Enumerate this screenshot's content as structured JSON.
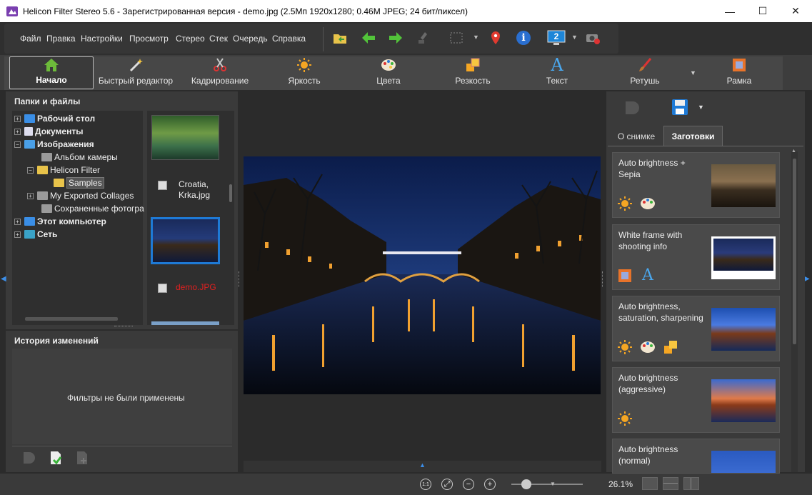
{
  "window": {
    "title": "Helicon Filter Stereo 5.6 - Зарегистрированная версия - demo.jpg (2.5Мп 1920x1280; 0.46М JPEG; 24 бит/пиксел)",
    "minimize_glyph": "—",
    "maximize_glyph": "☐",
    "close_glyph": "✕"
  },
  "menu": {
    "items": [
      "Файл",
      "Правка",
      "Настройки",
      "Просмотр",
      "Стерео",
      "Стек",
      "Очередь",
      "Справка"
    ]
  },
  "toolbar": {
    "icons": [
      "open-folder-icon",
      "back-arrow-icon",
      "forward-arrow-icon",
      "brush-icon",
      "selection-icon",
      "location-pin-icon",
      "info-icon",
      "monitor-icon",
      "camera-settings-icon"
    ],
    "monitor_number": "2",
    "info_glyph": "i"
  },
  "ribbon": {
    "tabs": [
      "Начало",
      "Быстрый редактор",
      "Кадрирование",
      "Яркость",
      "Цвета",
      "Резкость",
      "Текст",
      "Ретушь",
      "Рамка"
    ],
    "active": "Начало"
  },
  "folders": {
    "title": "Папки и файлы",
    "tree": [
      {
        "label": "Рабочий стол",
        "bold": true,
        "expand": "+"
      },
      {
        "label": "Документы",
        "bold": true,
        "expand": "+"
      },
      {
        "label": "Изображения",
        "bold": true,
        "expand": "−"
      },
      {
        "label": "Альбом камеры",
        "bold": false,
        "expand": ""
      },
      {
        "label": "Helicon Filter",
        "bold": false,
        "expand": "−"
      },
      {
        "label": "Samples",
        "bold": false,
        "expand": ""
      },
      {
        "label": "My Exported Collages",
        "bold": false,
        "expand": "+"
      },
      {
        "label": "Сохраненные фотогра",
        "bold": false,
        "expand": ""
      },
      {
        "label": "Этот компьютер",
        "bold": true,
        "expand": "+"
      },
      {
        "label": "Сеть",
        "bold": true,
        "expand": "+"
      }
    ]
  },
  "files": [
    {
      "name": "Croatia,\nKrka.jpg",
      "name_line1": "Croatia,",
      "name_line2": "Krka.jpg",
      "color": "#eeeeee"
    },
    {
      "name": "demo.JPG",
      "color": "#e02020"
    }
  ],
  "history": {
    "title": "История изменений",
    "empty_text": "Фильтры не были применены"
  },
  "right_panel": {
    "tabs": [
      "О снимке",
      "Заготовки"
    ],
    "active_tab": "Заготовки",
    "presets": [
      {
        "title": "Auto brightness + Sepia",
        "icons": [
          "brightness-icon",
          "palette-icon"
        ]
      },
      {
        "title": "White frame with shooting info",
        "icons": [
          "frame-icon",
          "text-icon"
        ]
      },
      {
        "title": "Auto brightness, saturation, sharpening",
        "icons": [
          "brightness-icon",
          "palette-icon",
          "sharpness-icon"
        ]
      },
      {
        "title": "Auto brightness (aggressive)",
        "icons": [
          "brightness-icon"
        ]
      },
      {
        "title": "Auto brightness (normal)",
        "icons": []
      }
    ]
  },
  "status": {
    "zoom": "26.1%",
    "fit_label": "1:1"
  },
  "colors": {
    "accent": "#1e7ad6",
    "title_bg": "#ffffff",
    "panel_bg": "#3a3a3a",
    "workspace": "#2b2b2b"
  }
}
